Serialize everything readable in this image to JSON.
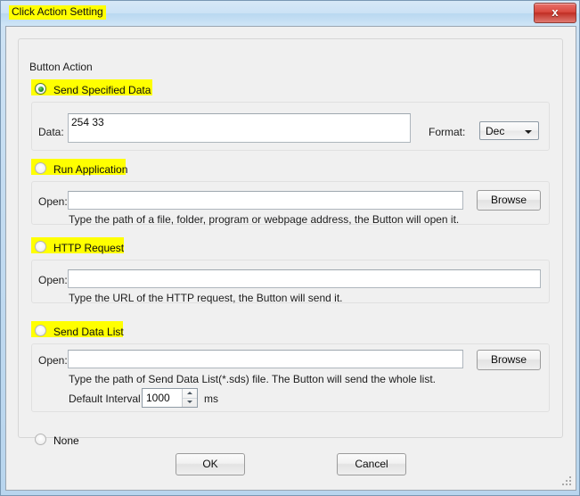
{
  "window": {
    "title": "Click Action Setting",
    "close_label": "x",
    "highlight_color": "#ffff00",
    "accent_color": "#b8d5ee"
  },
  "group": {
    "label": "Button Action"
  },
  "sections": {
    "send_specified_data": {
      "radio_label": "Send Specified Data",
      "selected": true,
      "data_label": "Data:",
      "data_value": "254 33",
      "format_label": "Format:",
      "format_value": "Dec"
    },
    "run_application": {
      "radio_label": "Run Application",
      "selected": false,
      "open_label": "Open:",
      "open_value": "",
      "browse_label": "Browse",
      "hint": "Type the path of a file, folder, program or webpage address, the Button will open it."
    },
    "http_request": {
      "radio_label": "HTTP Request",
      "selected": false,
      "open_label": "Open:",
      "open_value": "",
      "hint": "Type the URL of the HTTP request, the Button will send it."
    },
    "send_data_list": {
      "radio_label": "Send Data List",
      "selected": false,
      "open_label": "Open:",
      "open_value": "",
      "browse_label": "Browse",
      "hint": "Type the path of Send Data List(*.sds) file. The Button will send the whole list.",
      "interval_label": "Default Interval",
      "interval_value": "1000",
      "interval_unit": "ms"
    },
    "none": {
      "radio_label": "None",
      "selected": false
    }
  },
  "footer": {
    "ok_label": "OK",
    "cancel_label": "Cancel"
  }
}
